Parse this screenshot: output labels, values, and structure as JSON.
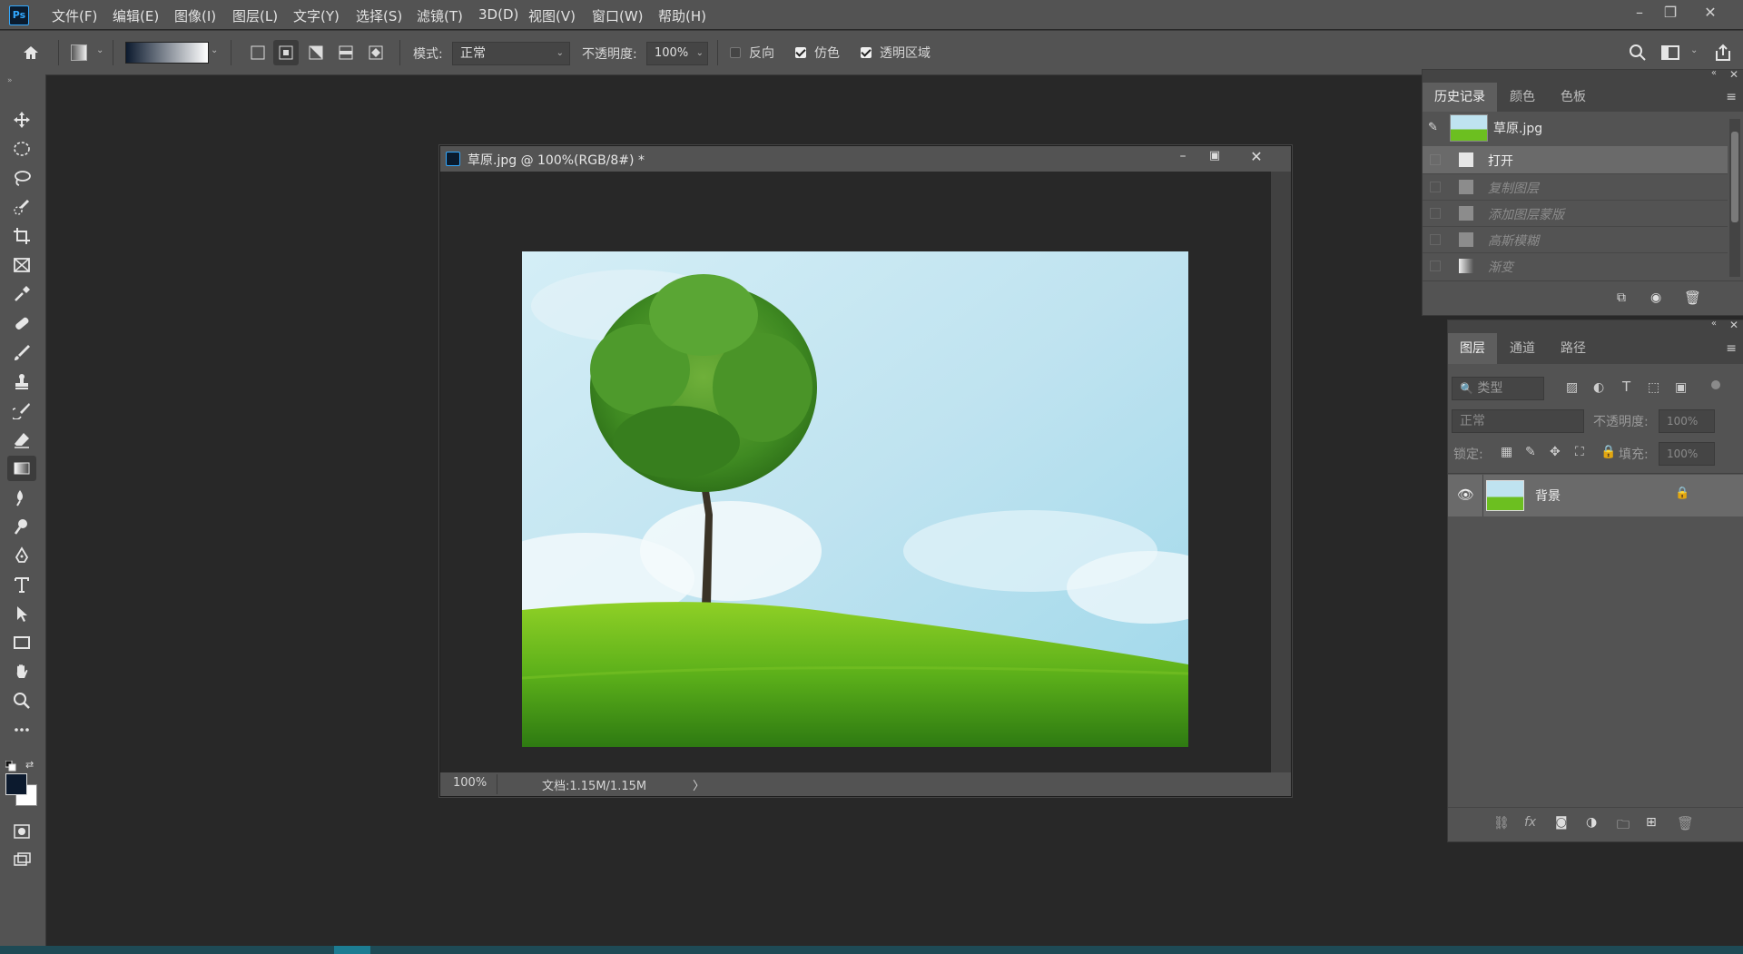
{
  "app": {
    "logo": "Ps"
  },
  "menu": [
    "文件(F)",
    "编辑(E)",
    "图像(I)",
    "图层(L)",
    "文字(Y)",
    "选择(S)",
    "滤镜(T)",
    "3D(D)",
    "视图(V)",
    "窗口(W)",
    "帮助(H)"
  ],
  "options": {
    "mode_label": "模式:",
    "mode_value": "正常",
    "opacity_label": "不透明度:",
    "opacity_value": "100%",
    "reverse_label": "反向",
    "dither_label": "仿色",
    "transparency_label": "透明区域",
    "reverse_checked": false,
    "dither_checked": true,
    "transparency_checked": true
  },
  "document": {
    "title": "草原.jpg @ 100%(RGB/8#) *",
    "zoom": "100%",
    "doc_info": "文档:1.15M/1.15M",
    "status_arrow": "〉"
  },
  "history_panel": {
    "tabs": [
      "历史记录",
      "颜色",
      "色板"
    ],
    "snapshot_name": "草原.jpg",
    "steps": [
      {
        "label": "打开",
        "active": true
      },
      {
        "label": "复制图层",
        "active": false
      },
      {
        "label": "添加图层蒙版",
        "active": false
      },
      {
        "label": "高斯模糊",
        "active": false
      },
      {
        "label": "渐变",
        "active": false
      }
    ]
  },
  "layers_panel": {
    "tabs": [
      "图层",
      "通道",
      "路径"
    ],
    "filter_placeholder": "类型",
    "blend_mode": "正常",
    "opacity_label": "不透明度:",
    "opacity_value": "100%",
    "lock_label": "锁定:",
    "fill_label": "填充:",
    "fill_value": "100%",
    "layers": [
      {
        "name": "背景",
        "visible": true,
        "locked": true
      }
    ],
    "footer_fx": "fx"
  },
  "colors": {
    "foreground": "#0c1a2e",
    "background": "#ffffff",
    "accent": "#31a8ff",
    "ui_bg": "#535353",
    "workspace_bg": "#282828"
  }
}
